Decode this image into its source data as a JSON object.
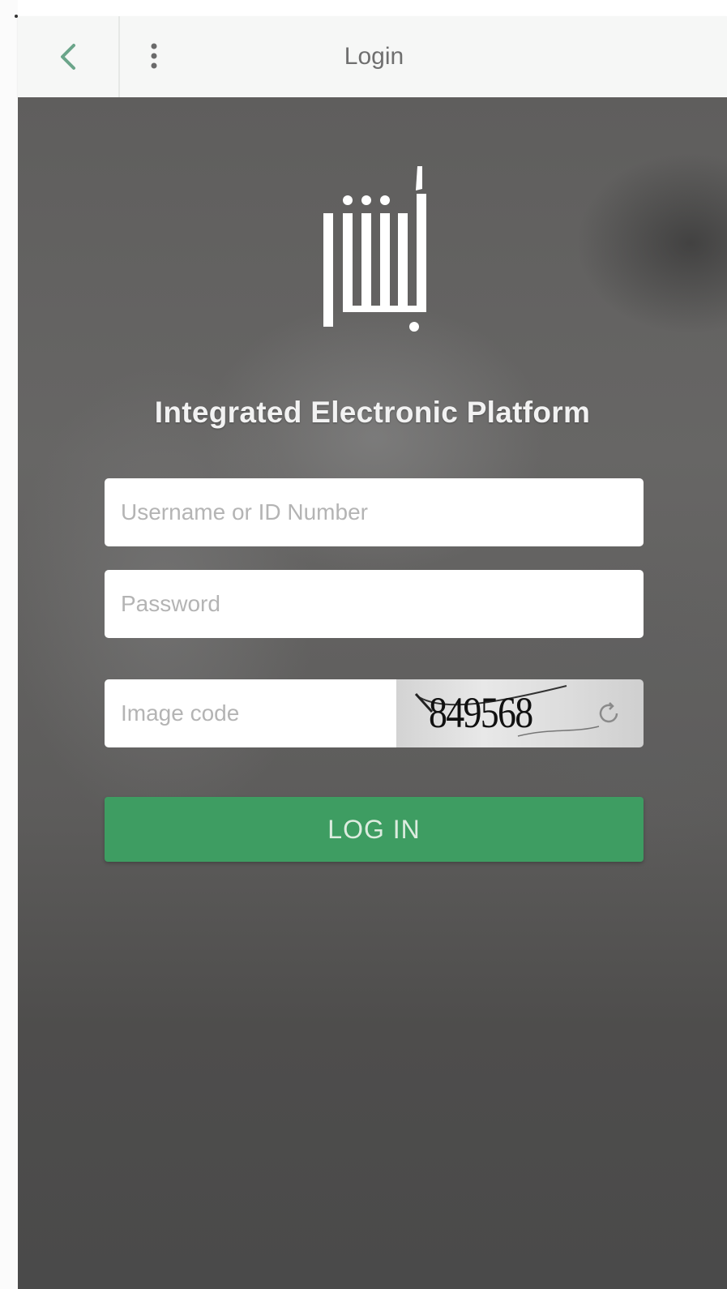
{
  "app_bar": {
    "title": "Login",
    "back_icon": "chevron-left-icon",
    "menu_icon": "more-vertical-icon"
  },
  "header": {
    "logo": "absher-logo",
    "platform_title": "Integrated Electronic Platform"
  },
  "form": {
    "username_placeholder": "Username or ID Number",
    "password_placeholder": "Password",
    "image_code_placeholder": "Image code",
    "captcha_text": "849568",
    "refresh_icon": "refresh-icon",
    "login_label": "LOG IN"
  },
  "colors": {
    "app_bar_bg": "#f6f7f6",
    "login_button": "#3e9d62",
    "background": "#5f5e5d"
  }
}
